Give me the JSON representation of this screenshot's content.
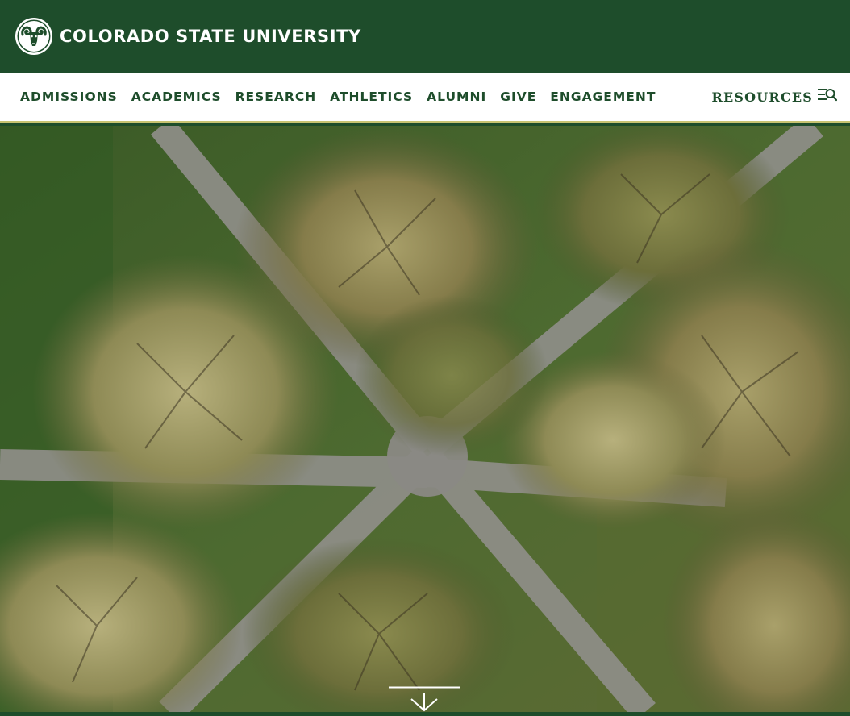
{
  "header": {
    "university_name": "COLORADO STATE UNIVERSITY",
    "logo_icon": "ram-logo-icon"
  },
  "nav": {
    "items": [
      {
        "label": "ADMISSIONS"
      },
      {
        "label": "ACADEMICS"
      },
      {
        "label": "RESEARCH"
      },
      {
        "label": "ATHLETICS"
      },
      {
        "label": "ALUMNI"
      },
      {
        "label": "GIVE"
      },
      {
        "label": "ENGAGEMENT"
      }
    ],
    "resources_label": "RESOURCES",
    "resources_icon": "menu-search-icon"
  },
  "hero": {
    "image": "aerial-campus-walkways-trees",
    "scroll_icon": "scroll-down-arrow-icon"
  },
  "colors": {
    "brand_green": "#1E4D2B",
    "gold_accent": "#C8C372",
    "white": "#FFFFFF"
  }
}
